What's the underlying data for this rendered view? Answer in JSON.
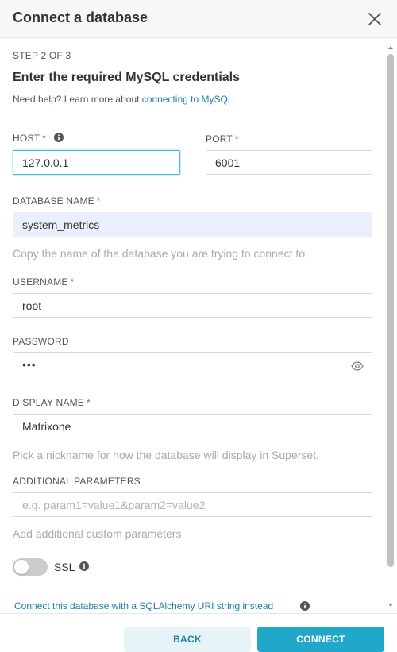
{
  "modal": {
    "title": "Connect a database",
    "close_icon": "close-icon"
  },
  "step": "STEP 2 OF 3",
  "section_title": "Enter the required MySQL credentials",
  "help": {
    "prefix": "Need help? Learn more about ",
    "link": "connecting to MySQL."
  },
  "fields": {
    "host": {
      "label": "HOST",
      "value": "127.0.0.1",
      "required": "*"
    },
    "port": {
      "label": "PORT",
      "value": "6001",
      "required": "*"
    },
    "database_name": {
      "label": "DATABASE NAME",
      "value": "system_metrics",
      "required": "*",
      "hint": "Copy the name of the database you are trying to connect to."
    },
    "username": {
      "label": "USERNAME",
      "value": "root",
      "required": "*"
    },
    "password": {
      "label": "PASSWORD",
      "value": "•••"
    },
    "display_name": {
      "label": "DISPLAY NAME",
      "value": "Matrixone",
      "required": "*",
      "hint": "Pick a nickname for how the database will display in Superset."
    },
    "additional_parameters": {
      "label": "ADDITIONAL PARAMETERS",
      "value": "",
      "placeholder": "e.g. param1=value1&param2=value2",
      "hint": "Add additional custom parameters"
    }
  },
  "ssl": {
    "label": "SSL",
    "enabled": false
  },
  "uri_link": "Connect this database with a SQLAlchemy URI string instead",
  "buttons": {
    "back": "BACK",
    "connect": "CONNECT"
  },
  "colors": {
    "accent": "#20a7c9",
    "link": "#1f7fa6",
    "required": "#e04355",
    "focus_border": "#45bed6",
    "autofill_bg": "#e8f0fe"
  }
}
